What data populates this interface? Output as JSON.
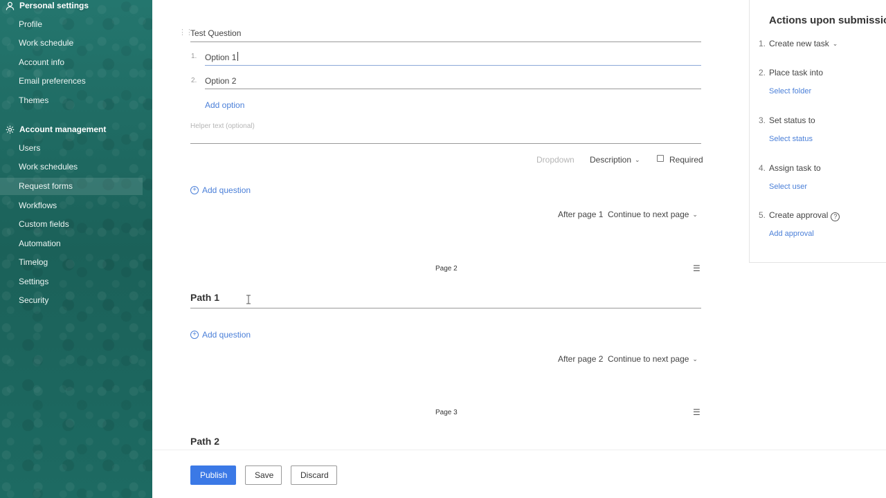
{
  "sidebar": {
    "personal_settings": {
      "title": "Personal settings",
      "items": [
        "Profile",
        "Work schedule",
        "Account info",
        "Email preferences",
        "Themes"
      ]
    },
    "account_management": {
      "title": "Account management",
      "items": [
        "Users",
        "Work schedules",
        "Request forms",
        "Workflows",
        "Custom fields",
        "Automation",
        "Timelog",
        "Settings",
        "Security"
      ],
      "active": "Request forms"
    }
  },
  "question": {
    "title": "Test Question",
    "options": [
      {
        "num": "1.",
        "text": "Option 1"
      },
      {
        "num": "2.",
        "text": "Option 2"
      }
    ],
    "add_option": "Add option",
    "helper_placeholder": "Helper text (optional)",
    "type_label": "Dropdown",
    "description_label": "Description",
    "required_label": "Required"
  },
  "add_question": "Add question",
  "page_nav": [
    {
      "after": "After page 1",
      "action": "Continue to next page"
    },
    {
      "after": "After page 2",
      "action": "Continue to next page"
    }
  ],
  "pages": [
    {
      "label": "Page 2",
      "title": "Path 1"
    },
    {
      "label": "Page 3",
      "title": "Path 2"
    }
  ],
  "actions_panel": {
    "title": "Actions upon submission",
    "steps": [
      {
        "num": "1.",
        "label": "Create new task",
        "link": ""
      },
      {
        "num": "2.",
        "label": "Place task into",
        "link": "Select folder"
      },
      {
        "num": "3.",
        "label": "Set status to",
        "link": "Select status"
      },
      {
        "num": "4.",
        "label": "Assign task to",
        "link": "Select user"
      },
      {
        "num": "5.",
        "label": "Create approval",
        "link": "Add approval"
      }
    ]
  },
  "buttons": {
    "publish": "Publish",
    "save": "Save",
    "discard": "Discard"
  },
  "colors": {
    "sidebar": "#1e6b64",
    "accent": "#3b79e6",
    "link": "#4a7fd8"
  }
}
